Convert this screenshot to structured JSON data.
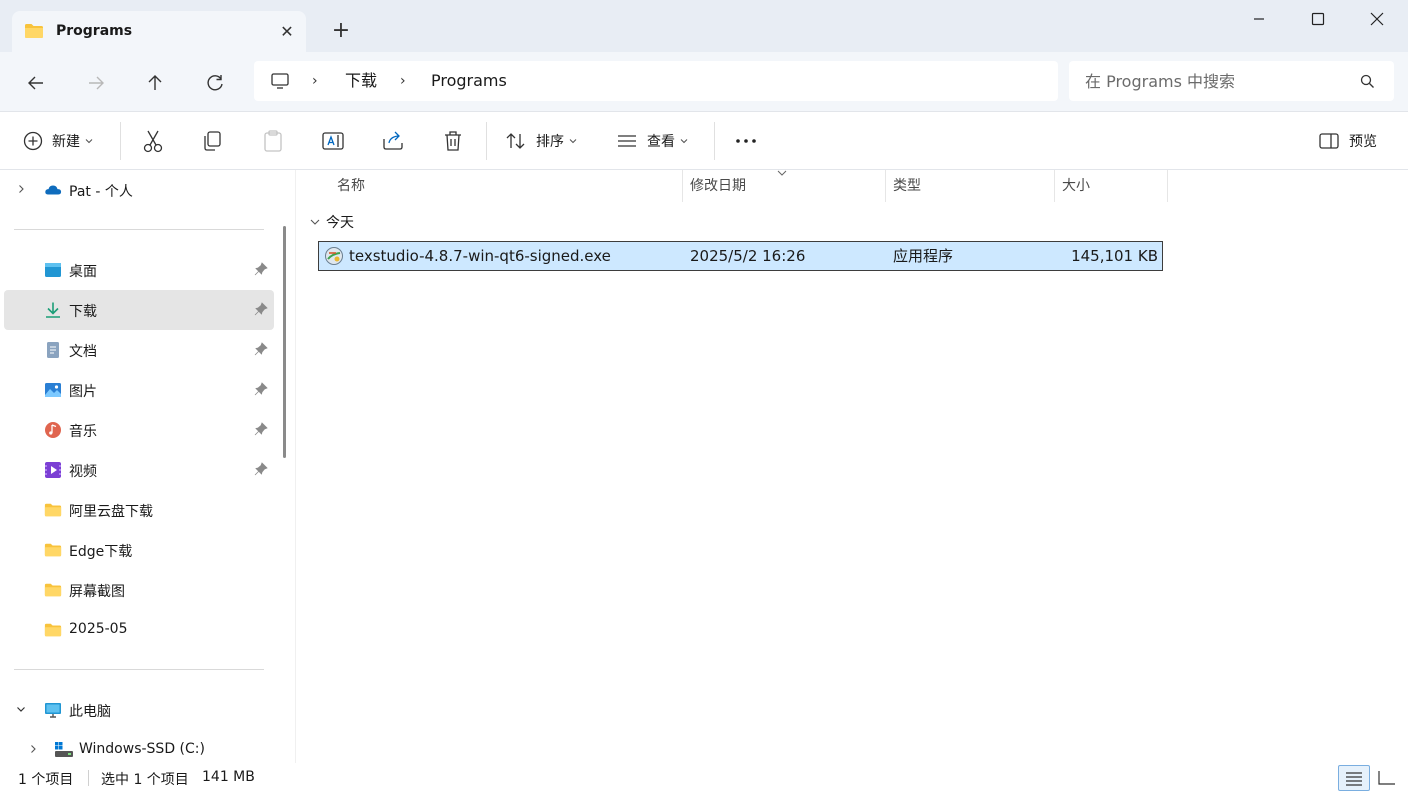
{
  "window": {
    "tab_title": "Programs",
    "minimize_label": "",
    "maximize_label": "",
    "close_label": ""
  },
  "address": {
    "crumbs": [
      "下载",
      "Programs"
    ]
  },
  "search": {
    "placeholder": "在 Programs 中搜索"
  },
  "toolbar": {
    "new_label": "新建",
    "sort_label": "排序",
    "view_label": "查看",
    "preview_label": "预览"
  },
  "sidebar": {
    "onedrive": "Pat - 个人",
    "quick_access": [
      {
        "label": "桌面",
        "pinned": true
      },
      {
        "label": "下载",
        "pinned": true
      },
      {
        "label": "文档",
        "pinned": true
      },
      {
        "label": "图片",
        "pinned": true
      },
      {
        "label": "音乐",
        "pinned": true
      },
      {
        "label": "视频",
        "pinned": true
      },
      {
        "label": "阿里云盘下载",
        "pinned": false
      },
      {
        "label": "Edge下载",
        "pinned": false
      },
      {
        "label": "屏幕截图",
        "pinned": false
      },
      {
        "label": "2025-05",
        "pinned": false
      }
    ],
    "this_pc": "此电脑",
    "drive": "Windows-SSD (C:)"
  },
  "columns": {
    "name": "名称",
    "modified": "修改日期",
    "type": "类型",
    "size": "大小"
  },
  "group": {
    "label": "今天"
  },
  "files": [
    {
      "name": "texstudio-4.8.7-win-qt6-signed.exe",
      "modified": "2025/5/2 16:26",
      "type": "应用程序",
      "size": "145,101 KB"
    }
  ],
  "status": {
    "count": "1 个项目",
    "selected": "选中 1 个项目",
    "selected_size": "141 MB"
  },
  "colors": {
    "accent": "#0067c0",
    "selection": "#cde8ff",
    "folder": "#f8c33c",
    "titlebar": "#e8edf4"
  }
}
